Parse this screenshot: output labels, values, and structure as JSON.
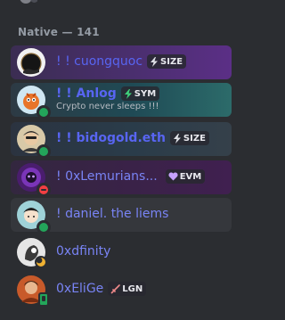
{
  "member_list": {
    "section": {
      "label": "Native — 141"
    },
    "members": [
      {
        "name": "! ! cuongquoc",
        "tag": "SIZE",
        "tag_icon": "lightning-icon",
        "status": "none",
        "activity": ""
      },
      {
        "name": "! ! Anlog",
        "tag": "SYM",
        "tag_icon": "lightning-icon",
        "status": "online",
        "activity": "Crypto never sleeps !!!"
      },
      {
        "name": "! ! bidogold.eth",
        "tag": "SIZE",
        "tag_icon": "lightning-icon",
        "status": "online",
        "activity": ""
      },
      {
        "name": "! 0xLemurians...",
        "tag": "EVM",
        "tag_icon": "heart-icon",
        "status": "dnd",
        "activity": ""
      },
      {
        "name": "! daniel. the liems",
        "tag": "",
        "tag_icon": "",
        "status": "online",
        "activity": ""
      },
      {
        "name": "0xdfinity",
        "tag": "",
        "tag_icon": "",
        "status": "moon",
        "activity": ""
      },
      {
        "name": "0xEliGe",
        "tag": "LGN",
        "tag_icon": "sword-icon",
        "status": "mobile",
        "activity": ""
      }
    ]
  },
  "colors": {
    "background": "#2b2d31",
    "name_blue": "#5865f2",
    "online": "#23a55a",
    "dnd": "#f23f43",
    "idle": "#f0b232"
  }
}
